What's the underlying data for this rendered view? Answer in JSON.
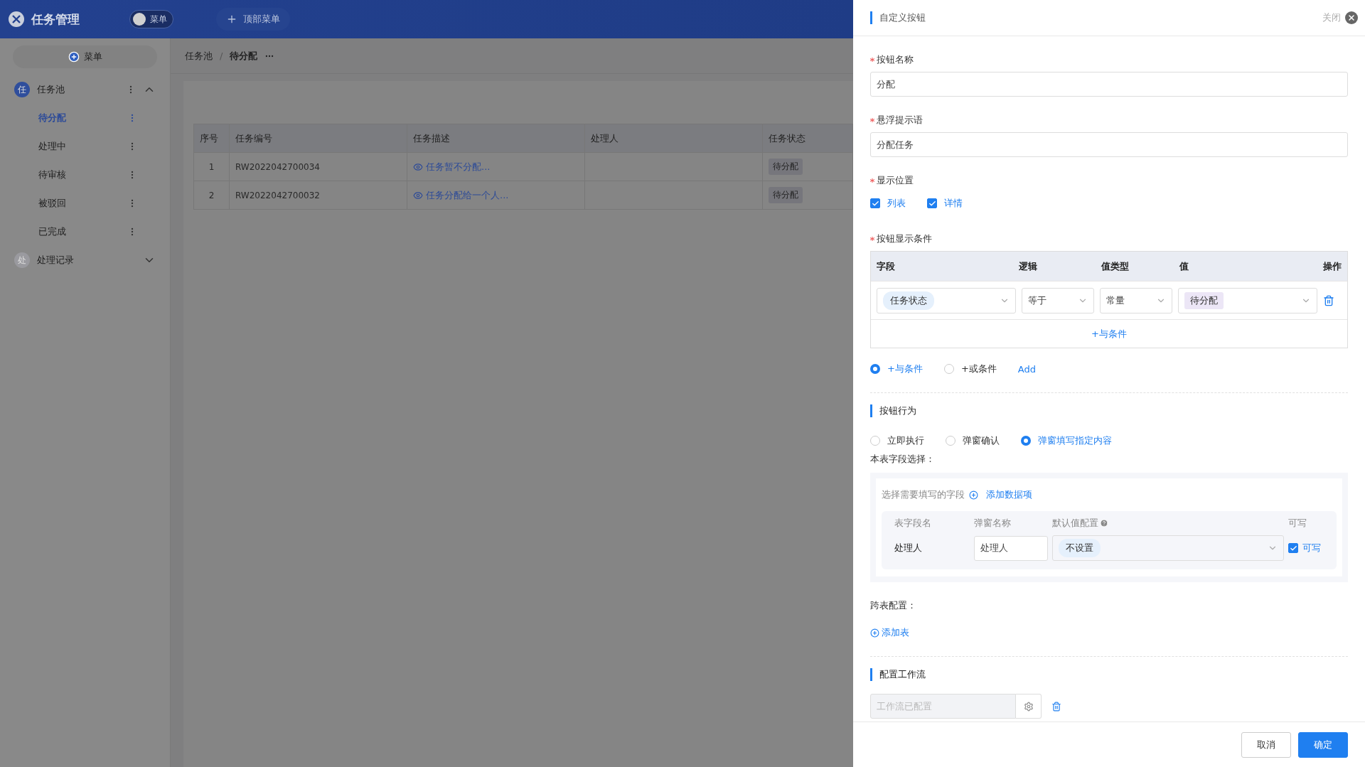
{
  "app": {
    "title": "任务管理",
    "menu_toggle": {
      "label": "菜单",
      "on": false
    },
    "top_menu_button": "顶部菜单",
    "sidebar": {
      "add_button": "菜单",
      "groups": [
        {
          "badge": "任",
          "label": "任务池",
          "expanded": true,
          "children": [
            {
              "label": "待分配",
              "selected": true
            },
            {
              "label": "处理中",
              "selected": false
            },
            {
              "label": "待审核",
              "selected": false
            },
            {
              "label": "被驳回",
              "selected": false
            },
            {
              "label": "已完成",
              "selected": false
            }
          ]
        },
        {
          "badge": "处",
          "label": "处理记录",
          "expanded": false
        }
      ]
    },
    "breadcrumb": {
      "items": [
        "任务池",
        "待分配"
      ],
      "separator": "/"
    },
    "table": {
      "columns": [
        "序号",
        "任务编号",
        "任务描述",
        "处理人",
        "任务状态"
      ],
      "rows": [
        {
          "index": "1",
          "number": "RW2022042700034",
          "description": "任务暂不分配...",
          "handler": "",
          "status": "待分配"
        },
        {
          "index": "2",
          "number": "RW2022042700032",
          "description": "任务分配给一个人...",
          "handler": "",
          "status": "待分配"
        }
      ]
    }
  },
  "drawer": {
    "title": "自定义按钮",
    "close_label": "关闭",
    "name_field": {
      "label": "按钮名称",
      "required": true,
      "value": "分配"
    },
    "tooltip_field": {
      "label": "悬浮提示语",
      "required": true,
      "value": "分配任务"
    },
    "position": {
      "label": "显示位置",
      "required": true,
      "options": [
        {
          "label": "列表",
          "checked": true
        },
        {
          "label": "详情",
          "checked": true
        }
      ]
    },
    "conditions": {
      "label": "按钮显示条件",
      "required": true,
      "columns": [
        "字段",
        "逻辑",
        "值类型",
        "值",
        "操作"
      ],
      "rows": [
        {
          "field": "任务状态",
          "logic": "等于",
          "value_type": "常量",
          "value": "待分配"
        }
      ],
      "add_link": "+与条件",
      "modes": [
        {
          "label": "+与条件",
          "selected": true
        },
        {
          "label": "+或条件",
          "selected": false
        }
      ],
      "add_button": "Add"
    },
    "behavior": {
      "title": "按钮行为",
      "options": [
        {
          "label": "立即执行",
          "selected": false
        },
        {
          "label": "弹窗确认",
          "selected": false
        },
        {
          "label": "弹窗填写指定内容",
          "selected": true
        }
      ],
      "field_select_label": "本表字段选择：",
      "hint": "选择需要填写的字段",
      "add_link": "添加数据项",
      "columns": [
        "表字段名",
        "弹窗名称",
        "默认值配置",
        "可写"
      ],
      "rows": [
        {
          "name": "处理人",
          "popup_name": "处理人",
          "default": "不设置",
          "writable": true,
          "writable_label": "可写"
        }
      ],
      "cross_label": "跨表配置：",
      "cross_add": "添加表"
    },
    "workflow": {
      "title": "配置工作流",
      "placeholder": "工作流已配置",
      "disabled": true
    },
    "buttons": [
      {
        "label": "取消",
        "kind": "default"
      },
      {
        "label": "确定",
        "kind": "primary"
      }
    ]
  }
}
